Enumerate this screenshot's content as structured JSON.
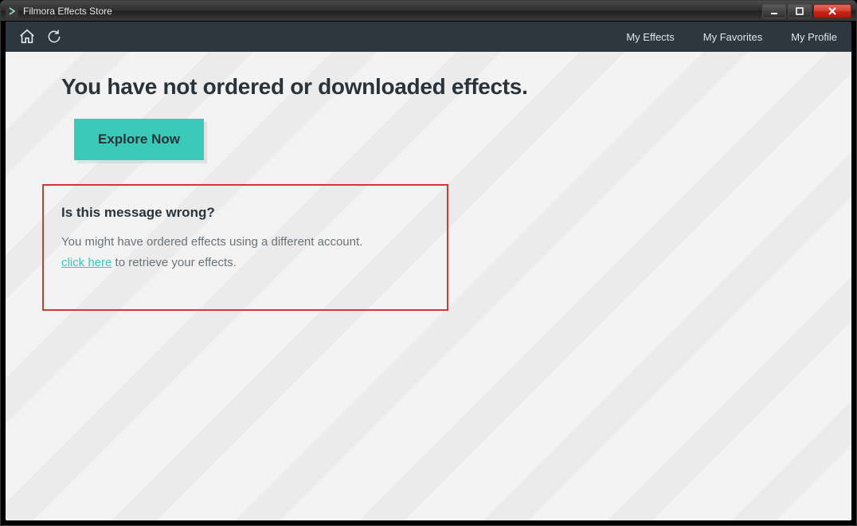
{
  "window": {
    "title": "Filmora Effects Store"
  },
  "toolbar": {
    "nav": {
      "my_effects": "My Effects",
      "my_favorites": "My Favorites",
      "my_profile": "My Profile"
    }
  },
  "main": {
    "headline": "You have not ordered or downloaded effects.",
    "explore_label": "Explore Now",
    "wrong_box": {
      "title": "Is this message wrong?",
      "line1": "You might have ordered effects using a different account.",
      "click_here": "click here",
      "line2_suffix": " to retrieve your effects."
    }
  }
}
